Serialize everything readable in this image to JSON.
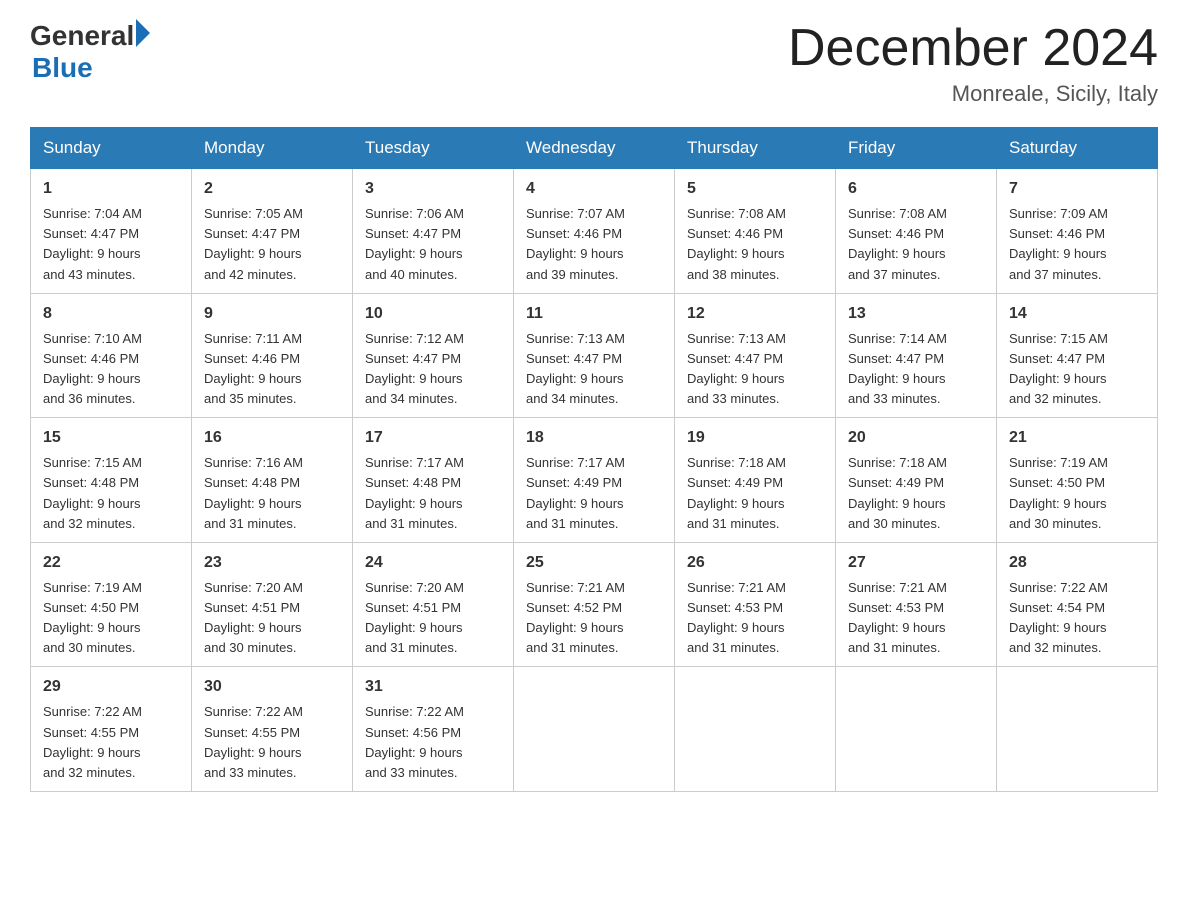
{
  "header": {
    "logo_general": "General",
    "logo_blue": "Blue",
    "month_title": "December 2024",
    "location": "Monreale, Sicily, Italy"
  },
  "days_of_week": [
    "Sunday",
    "Monday",
    "Tuesday",
    "Wednesday",
    "Thursday",
    "Friday",
    "Saturday"
  ],
  "weeks": [
    [
      {
        "day": "1",
        "sunrise": "7:04 AM",
        "sunset": "4:47 PM",
        "daylight": "9 hours and 43 minutes."
      },
      {
        "day": "2",
        "sunrise": "7:05 AM",
        "sunset": "4:47 PM",
        "daylight": "9 hours and 42 minutes."
      },
      {
        "day": "3",
        "sunrise": "7:06 AM",
        "sunset": "4:47 PM",
        "daylight": "9 hours and 40 minutes."
      },
      {
        "day": "4",
        "sunrise": "7:07 AM",
        "sunset": "4:46 PM",
        "daylight": "9 hours and 39 minutes."
      },
      {
        "day": "5",
        "sunrise": "7:08 AM",
        "sunset": "4:46 PM",
        "daylight": "9 hours and 38 minutes."
      },
      {
        "day": "6",
        "sunrise": "7:08 AM",
        "sunset": "4:46 PM",
        "daylight": "9 hours and 37 minutes."
      },
      {
        "day": "7",
        "sunrise": "7:09 AM",
        "sunset": "4:46 PM",
        "daylight": "9 hours and 37 minutes."
      }
    ],
    [
      {
        "day": "8",
        "sunrise": "7:10 AM",
        "sunset": "4:46 PM",
        "daylight": "9 hours and 36 minutes."
      },
      {
        "day": "9",
        "sunrise": "7:11 AM",
        "sunset": "4:46 PM",
        "daylight": "9 hours and 35 minutes."
      },
      {
        "day": "10",
        "sunrise": "7:12 AM",
        "sunset": "4:47 PM",
        "daylight": "9 hours and 34 minutes."
      },
      {
        "day": "11",
        "sunrise": "7:13 AM",
        "sunset": "4:47 PM",
        "daylight": "9 hours and 34 minutes."
      },
      {
        "day": "12",
        "sunrise": "7:13 AM",
        "sunset": "4:47 PM",
        "daylight": "9 hours and 33 minutes."
      },
      {
        "day": "13",
        "sunrise": "7:14 AM",
        "sunset": "4:47 PM",
        "daylight": "9 hours and 33 minutes."
      },
      {
        "day": "14",
        "sunrise": "7:15 AM",
        "sunset": "4:47 PM",
        "daylight": "9 hours and 32 minutes."
      }
    ],
    [
      {
        "day": "15",
        "sunrise": "7:15 AM",
        "sunset": "4:48 PM",
        "daylight": "9 hours and 32 minutes."
      },
      {
        "day": "16",
        "sunrise": "7:16 AM",
        "sunset": "4:48 PM",
        "daylight": "9 hours and 31 minutes."
      },
      {
        "day": "17",
        "sunrise": "7:17 AM",
        "sunset": "4:48 PM",
        "daylight": "9 hours and 31 minutes."
      },
      {
        "day": "18",
        "sunrise": "7:17 AM",
        "sunset": "4:49 PM",
        "daylight": "9 hours and 31 minutes."
      },
      {
        "day": "19",
        "sunrise": "7:18 AM",
        "sunset": "4:49 PM",
        "daylight": "9 hours and 31 minutes."
      },
      {
        "day": "20",
        "sunrise": "7:18 AM",
        "sunset": "4:49 PM",
        "daylight": "9 hours and 30 minutes."
      },
      {
        "day": "21",
        "sunrise": "7:19 AM",
        "sunset": "4:50 PM",
        "daylight": "9 hours and 30 minutes."
      }
    ],
    [
      {
        "day": "22",
        "sunrise": "7:19 AM",
        "sunset": "4:50 PM",
        "daylight": "9 hours and 30 minutes."
      },
      {
        "day": "23",
        "sunrise": "7:20 AM",
        "sunset": "4:51 PM",
        "daylight": "9 hours and 30 minutes."
      },
      {
        "day": "24",
        "sunrise": "7:20 AM",
        "sunset": "4:51 PM",
        "daylight": "9 hours and 31 minutes."
      },
      {
        "day": "25",
        "sunrise": "7:21 AM",
        "sunset": "4:52 PM",
        "daylight": "9 hours and 31 minutes."
      },
      {
        "day": "26",
        "sunrise": "7:21 AM",
        "sunset": "4:53 PM",
        "daylight": "9 hours and 31 minutes."
      },
      {
        "day": "27",
        "sunrise": "7:21 AM",
        "sunset": "4:53 PM",
        "daylight": "9 hours and 31 minutes."
      },
      {
        "day": "28",
        "sunrise": "7:22 AM",
        "sunset": "4:54 PM",
        "daylight": "9 hours and 32 minutes."
      }
    ],
    [
      {
        "day": "29",
        "sunrise": "7:22 AM",
        "sunset": "4:55 PM",
        "daylight": "9 hours and 32 minutes."
      },
      {
        "day": "30",
        "sunrise": "7:22 AM",
        "sunset": "4:55 PM",
        "daylight": "9 hours and 33 minutes."
      },
      {
        "day": "31",
        "sunrise": "7:22 AM",
        "sunset": "4:56 PM",
        "daylight": "9 hours and 33 minutes."
      },
      null,
      null,
      null,
      null
    ]
  ]
}
